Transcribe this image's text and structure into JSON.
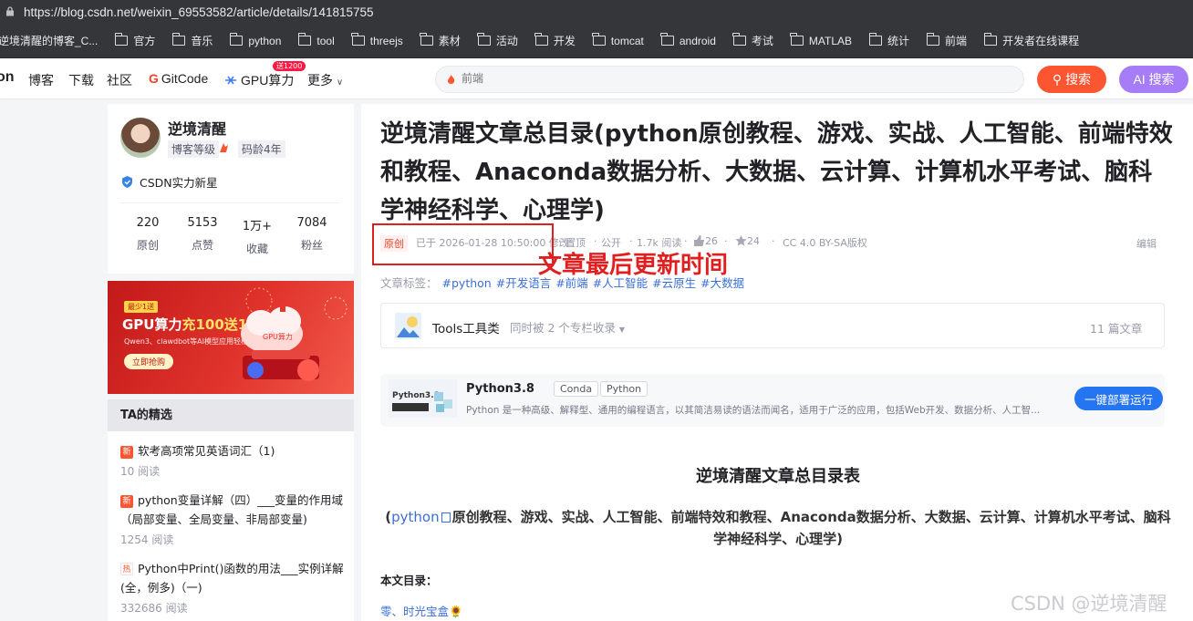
{
  "browser": {
    "url": "https://blog.csdn.net/weixin_69553582/article/details/141815755",
    "bookmarks": [
      "逆境清醒的博客_C...",
      "官方",
      "音乐",
      "python",
      "tool",
      "threejs",
      "素材",
      "活动",
      "开发",
      "tomcat",
      "android",
      "考试",
      "MATLAB",
      "统计",
      "前端",
      "开发者在线课程"
    ]
  },
  "nav": {
    "logo_fragment": "on",
    "items": [
      "博客",
      "下载",
      "社区",
      "GitCode",
      "GPU算力",
      "更多"
    ],
    "gpu_badge": "送1200",
    "search_placeholder": "前端",
    "search_label": "搜索",
    "ai_label": "AI 搜索",
    "accent_color": "#fc5531",
    "ai_color": "#a77cf7"
  },
  "profile": {
    "name": "逆境清醒",
    "level_label": "博客等级",
    "age": "码龄4年",
    "honor": "CSDN实力新星",
    "stats": [
      {
        "value": "220",
        "label": "原创"
      },
      {
        "value": "5153",
        "label": "点赞"
      },
      {
        "value": "1万+",
        "label": "收藏"
      },
      {
        "value": "7084",
        "label": "粉丝"
      }
    ]
  },
  "banner": {
    "tag": "最少1送",
    "headline_a": "GPU算力",
    "headline_b": "充100送100",
    "sub": "Qwen3、clawdbot等AI模型应用轻松部署",
    "cta": "立即抢购",
    "badge": "GPU算力"
  },
  "picks": {
    "title": "TA的精选",
    "items": [
      {
        "badge": "新",
        "title": "软考高项常见英语词汇（1)",
        "reads": "10 阅读"
      },
      {
        "badge": "新",
        "title": "python变量详解（四）___变量的作用域（局部变量、全局变量、非局部变量)",
        "reads": "1254 阅读"
      },
      {
        "badge": "热",
        "title": "Python中Print()函数的用法___实例详解(全，例多)（一)",
        "reads": "332686 阅读"
      }
    ]
  },
  "article": {
    "title": "逆境清醒文章总目录(python原创教程、游戏、实战、人工智能、前端特效和教程、Anaconda数据分析、大数据、云计算、计算机水平考试、脑科学神经科学、心理学)",
    "type": "原创",
    "modified": "已于 2026-01-28 10:50:00 修改",
    "pinned": "置顶",
    "public": "公开",
    "reads": "1.7k 阅读",
    "likes": "26",
    "favs": "24",
    "license": "CC 4.0 BY-SA版权",
    "edit": "编辑",
    "annotation": "文章最后更新时间",
    "tags_label": "文章标签：",
    "tags": [
      "#python",
      "#开发语言",
      "#前端",
      "#人工智能",
      "#云原生",
      "#大数据"
    ],
    "column": {
      "name": "Tools工具类",
      "included": "同时被 2 个专栏收录",
      "count": "11 篇文章"
    },
    "py_card": {
      "name": "Python3.8",
      "chips": [
        "Conda",
        "Python"
      ],
      "desc": "Python 是一种高级、解释型、通用的编程语言，以其简洁易读的语法而闻名，适用于广泛的应用，包括Web开发、数据分析、人工智...",
      "run": "一键部署运行",
      "thumb_label": "Python3.8"
    },
    "heading": "逆境清醒文章总目录表",
    "subheading_link": "python",
    "subheading_rest": "原创教程、游戏、实战、人工智能、前端特效和教程、Anaconda数据分析、大数据、云计算、计算机水平考试、脑科学神经科学、心理学)",
    "subheading_open": "(",
    "toc_label": "本文目录：",
    "toc_first": "零、时光宝盒🌻",
    "watermark": "CSDN @逆境清醒"
  }
}
